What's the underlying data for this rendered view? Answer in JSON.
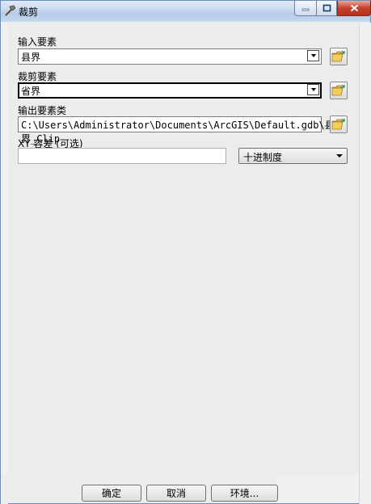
{
  "window": {
    "title": "裁剪",
    "icon": "hammer-icon"
  },
  "controls": {
    "minimize_icon": "minimize-icon",
    "maximize_icon": "maximize-icon",
    "close_icon": "close-icon"
  },
  "form": {
    "input_features": {
      "label": "输入要素",
      "value": "县界"
    },
    "clip_features": {
      "label": "裁剪要素",
      "value": "省界"
    },
    "output_feature_class": {
      "label": "输出要素类",
      "value": "C:\\Users\\Administrator\\Documents\\ArcGIS\\Default.gdb\\县界_Clip"
    },
    "xy_tolerance": {
      "label": "XY 容差 (可选)",
      "value": "",
      "unit": "十进制度"
    }
  },
  "buttons": {
    "ok": "确定",
    "cancel": "取消",
    "environments": "环境..."
  }
}
